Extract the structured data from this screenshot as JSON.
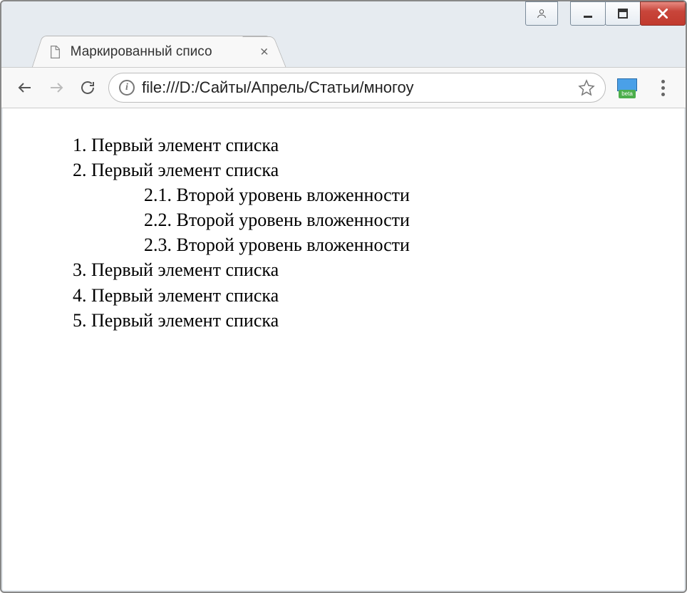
{
  "window": {
    "controls": {
      "user": "user-icon",
      "minimize": "minimize-icon",
      "maximize": "maximize-icon",
      "close": "close-icon"
    }
  },
  "tab": {
    "title": "Маркированный списо",
    "icon": "document-icon"
  },
  "toolbar": {
    "back": "back",
    "forward": "forward",
    "reload": "reload",
    "info": "i",
    "url": "file:///D:/Сайты/Апрель/Статьи/многоу",
    "star": "bookmark-star",
    "extension_badge": "beta",
    "menu": "menu"
  },
  "content": {
    "items": [
      {
        "indent": 0,
        "text": "1. Первый элемент списка"
      },
      {
        "indent": 0,
        "text": "2. Первый элемент списка"
      },
      {
        "indent": 1,
        "text": "2.1. Второй уровень вложенности"
      },
      {
        "indent": 1,
        "text": "2.2. Второй уровень вложенности"
      },
      {
        "indent": 1,
        "text": "2.3. Второй уровень вложенности"
      },
      {
        "indent": 0,
        "text": "3. Первый элемент списка"
      },
      {
        "indent": 0,
        "text": "4. Первый элемент списка"
      },
      {
        "indent": 0,
        "text": "5. Первый элемент списка"
      }
    ]
  }
}
